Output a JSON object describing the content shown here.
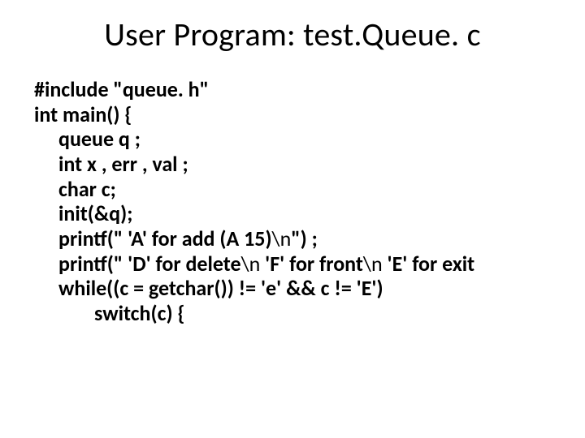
{
  "title": "User Program: test.Queue. c",
  "lines": [
    {
      "indent": 0,
      "segments": [
        {
          "text": "#include \"queue. h\"",
          "bold": true
        }
      ]
    },
    {
      "indent": 0,
      "segments": [
        {
          "text": "int main() {",
          "bold": true
        }
      ]
    },
    {
      "indent": 1,
      "segments": [
        {
          "text": "queue q ;",
          "bold": true
        }
      ]
    },
    {
      "indent": 1,
      "segments": [
        {
          "text": "int x , err , val ;",
          "bold": true
        }
      ]
    },
    {
      "indent": 1,
      "segments": [
        {
          "text": "char c;",
          "bold": true
        }
      ]
    },
    {
      "indent": 1,
      "segments": [
        {
          "text": "init(&q);",
          "bold": true
        }
      ]
    },
    {
      "indent": 1,
      "segments": [
        {
          "text": "printf(\" 'A' for add (A 15)",
          "bold": true
        },
        {
          "text": "\\n",
          "bold": false
        },
        {
          "text": "\") ;",
          "bold": true
        }
      ]
    },
    {
      "indent": 1,
      "segments": [
        {
          "text": "printf(\" 'D' for delete",
          "bold": true
        },
        {
          "text": "\\n",
          "bold": false
        },
        {
          "text": " 'F' for front",
          "bold": true
        },
        {
          "text": "\\n",
          "bold": false
        },
        {
          "text": " 'E' for exit",
          "bold": true
        }
      ]
    },
    {
      "indent": 1,
      "segments": [
        {
          "text": "while((c = getchar()) != 'e' && c != 'E')",
          "bold": true
        }
      ]
    },
    {
      "indent": 2,
      "segments": [
        {
          "text": "switch(c) {",
          "bold": true
        }
      ]
    }
  ]
}
